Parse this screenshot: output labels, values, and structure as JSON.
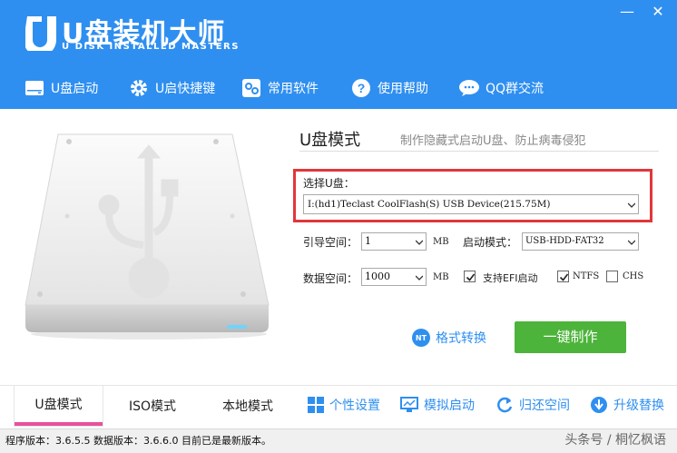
{
  "app": {
    "title": "U盘装机大师",
    "subtitle": "U DISK INSTALLED MASTERS",
    "window_controls": {
      "minimize": "—",
      "close": "✕"
    }
  },
  "nav": [
    {
      "label": "U盘启动",
      "icon": "usb-drive-icon"
    },
    {
      "label": "U启快捷键",
      "icon": "gear-icon"
    },
    {
      "label": "常用软件",
      "icon": "software-icon"
    },
    {
      "label": "使用帮助",
      "icon": "help-icon"
    },
    {
      "label": "QQ群交流",
      "icon": "chat-icon"
    }
  ],
  "panel": {
    "mode_title": "U盘模式",
    "mode_desc": "制作隐藏式启动U盘、防止病毒侵犯",
    "select_label": "选择U盘：",
    "select_value": "I:(hd1)Teclast CoolFlash(S) USB Device(215.75M)",
    "boot_space_label": "引导空间：",
    "boot_space_value": "1",
    "boot_space_unit": "MB",
    "boot_mode_label": "启动模式：",
    "boot_mode_value": "USB-HDD-FAT32",
    "data_space_label": "数据空间：",
    "data_space_value": "1000",
    "data_space_unit": "MB",
    "checkboxes": [
      {
        "label": "支持EFI启动",
        "checked": true
      },
      {
        "label": "NTFS",
        "checked": true
      },
      {
        "label": "CHS",
        "checked": false
      }
    ],
    "convert_icon_text": "NT",
    "convert_label": "格式转换",
    "make_button": "一键制作"
  },
  "tabs": [
    {
      "label": "U盘模式",
      "active": true
    },
    {
      "label": "ISO模式",
      "active": false
    },
    {
      "label": "本地模式",
      "active": false
    }
  ],
  "tools": [
    {
      "label": "个性设置",
      "icon": "grid-icon"
    },
    {
      "label": "模拟启动",
      "icon": "monitor-icon"
    },
    {
      "label": "归还空间",
      "icon": "refresh-icon"
    },
    {
      "label": "升级替换",
      "icon": "download-icon"
    }
  ],
  "status": "程序版本：3.6.5.5   数据版本：3.6.6.0  目前已是最新版本。",
  "watermark": "头条号 / 桐忆枫语",
  "colors": {
    "brand_blue": "#2f8ff0",
    "make_green": "#4cb43a",
    "highlight_red": "#e0373a",
    "tab_pink": "#e9509b"
  }
}
